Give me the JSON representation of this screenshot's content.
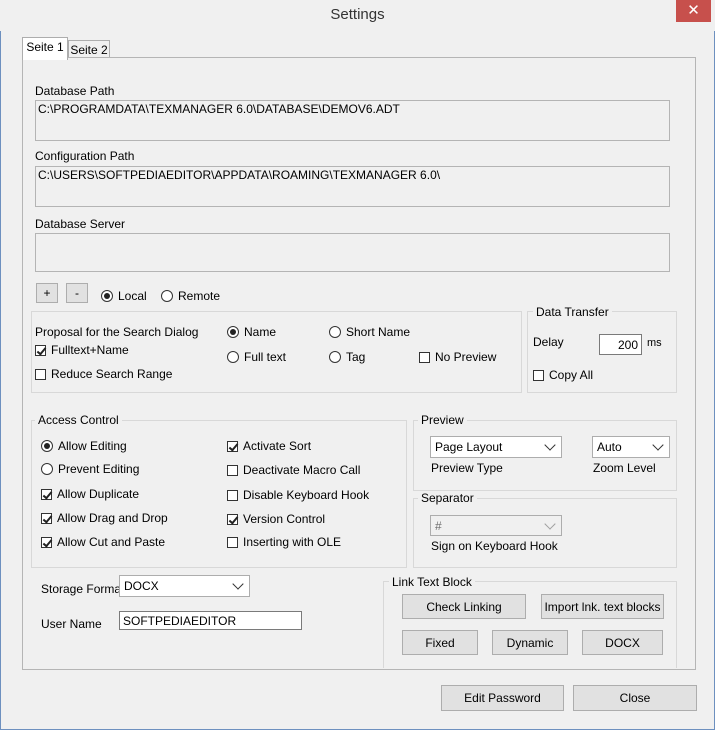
{
  "window": {
    "title": "Settings",
    "close_glyph": "✕"
  },
  "tabs": [
    "Seite 1",
    "Seite 2"
  ],
  "paths": {
    "db_path_label": "Database Path",
    "db_path_value": "C:\\PROGRAMDATA\\TEXMANAGER 6.0\\DATABASE\\DEMOV6.ADT",
    "config_path_label": "Configuration Path",
    "config_path_value": "C:\\USERS\\SOFTPEDIAEDITOR\\APPDATA\\ROAMING\\TEXMANAGER 6.0\\",
    "db_server_label": "Database Server",
    "db_server_value": ""
  },
  "server": {
    "plus": "+",
    "minus": "-",
    "local": "Local",
    "remote": "Remote"
  },
  "search": {
    "title": "Proposal for the Search Dialog",
    "fulltext_name": "Fulltext+Name",
    "reduce_range": "Reduce Search Range",
    "name": "Name",
    "short_name": "Short Name",
    "full_text": "Full text",
    "tag": "Tag",
    "no_preview": "No Preview"
  },
  "transfer": {
    "title": "Data Transfer",
    "delay": "Delay",
    "delay_value": "200",
    "unit": "ms",
    "copy_all": "Copy All"
  },
  "access": {
    "title": "Access Control",
    "allow_editing": "Allow Editing",
    "prevent_editing": "Prevent Editing",
    "allow_duplicate": "Allow Duplicate",
    "allow_drag_drop": "Allow Drag and Drop",
    "allow_cut_paste": "Allow Cut and Paste",
    "activate_sort": "Activate Sort",
    "deactivate_macro": "Deactivate Macro Call",
    "disable_keyboard_hook": "Disable Keyboard Hook",
    "version_control": "Version Control",
    "inserting_ole": "Inserting with OLE"
  },
  "preview": {
    "title": "Preview",
    "type_value": "Page Layout",
    "type_label": "Preview Type",
    "zoom_value": "Auto",
    "zoom_label": "Zoom Level"
  },
  "separator": {
    "title": "Separator",
    "value": "#",
    "label": "Sign on Keyboard Hook"
  },
  "storage": {
    "label": "Storage Format",
    "value": "DOCX",
    "user_label": "User Name",
    "user_value": "SOFTPEDIAEDITOR"
  },
  "link": {
    "title": "Link Text Block",
    "check_linking": "Check Linking",
    "import": "Import lnk. text blocks",
    "fixed": "Fixed",
    "dynamic": "Dynamic",
    "docx": "DOCX"
  },
  "footer": {
    "edit_password": "Edit Password",
    "close": "Close"
  }
}
